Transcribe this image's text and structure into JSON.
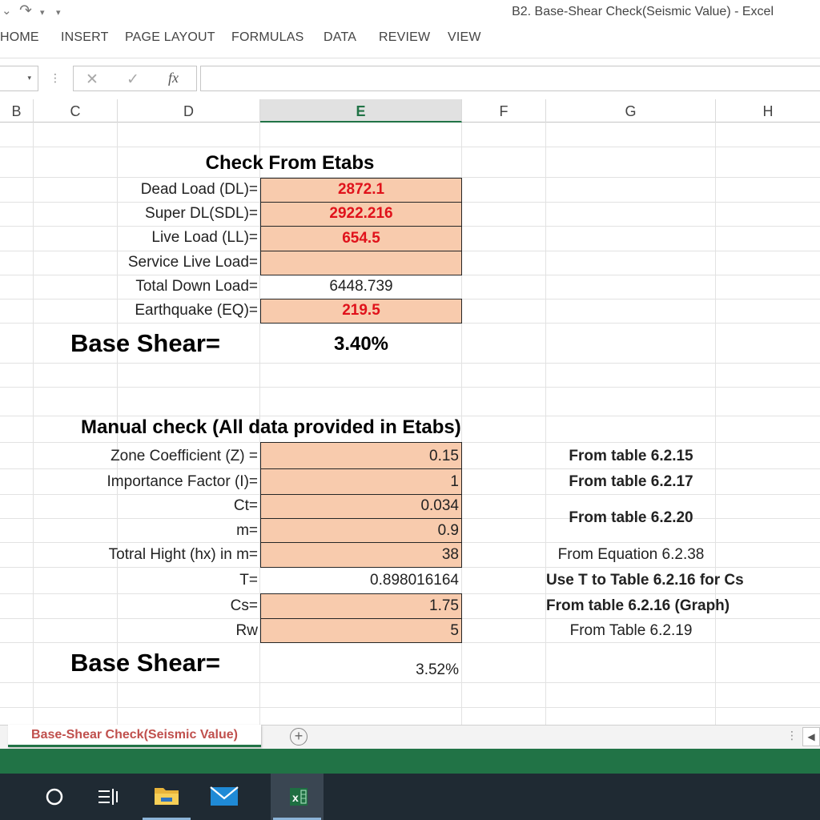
{
  "window": {
    "title": "B2. Base-Shear Check(Seismic Value) - Excel"
  },
  "quick_access": {
    "redo_icon": "redo-icon",
    "customize_icon": "customize-qat-icon"
  },
  "ribbon": {
    "tabs": [
      "HOME",
      "INSERT",
      "PAGE LAYOUT",
      "FORMULAS",
      "DATA",
      "REVIEW",
      "VIEW"
    ]
  },
  "formula_bar": {
    "cancel_icon": "✕",
    "enter_icon": "✓",
    "fx_label": "fx",
    "value": ""
  },
  "columns": [
    "B",
    "C",
    "D",
    "E",
    "F",
    "G",
    "H"
  ],
  "selected_column": "E",
  "sheet": {
    "etabs": {
      "title": "Check From Etabs",
      "rows": [
        {
          "label": "Dead Load (DL)=",
          "value": "2872.1"
        },
        {
          "label": "Super DL(SDL)=",
          "value": "2922.216"
        },
        {
          "label": "Live Load (LL)=",
          "value": "654.5"
        },
        {
          "label": "Service Live Load=",
          "value": ""
        },
        {
          "label": "Total Down Load=",
          "value": "6448.739"
        },
        {
          "label": "Earthquake (EQ)=",
          "value": "219.5"
        }
      ],
      "base_shear_label": "Base Shear=",
      "base_shear_value": "3.40%"
    },
    "manual": {
      "title": "Manual check  (All data provided in Etabs)",
      "rows": [
        {
          "label": "Zone Coefficient (Z) =",
          "value": "0.15"
        },
        {
          "label": "Importance Factor (I)=",
          "value": "1"
        },
        {
          "label": "Ct=",
          "value": "0.034"
        },
        {
          "label": "m=",
          "value": "0.9"
        },
        {
          "label": "Totral Hight (hx) in m=",
          "value": "38"
        },
        {
          "label": "T=",
          "value": "0.898016164"
        },
        {
          "label": "Cs=",
          "value": "1.75"
        },
        {
          "label": "Rw",
          "value": "5"
        }
      ],
      "notes": [
        "From table 6.2.15",
        "From table 6.2.17",
        "From table 6.2.20",
        "From Equation 6.2.38",
        "Use T to Table 6.2.16 for Cs",
        "From table 6.2.16 (Graph)",
        "From Table 6.2.19"
      ],
      "base_shear_label": "Base Shear=",
      "base_shear_value": "3.52%"
    }
  },
  "sheet_tabs": {
    "active": "Base-Shear Check(Seismic Value)",
    "add_icon": "+"
  },
  "colors": {
    "excel_green": "#217346",
    "input_fill": "#f8cbad",
    "input_text": "#e0121b",
    "sheet_tab_text": "#c0504d"
  },
  "taskbar": {
    "items": [
      "cortana-search-icon",
      "task-view-icon",
      "file-explorer-icon",
      "mail-icon",
      "excel-app-icon"
    ],
    "excel_label": "x"
  }
}
